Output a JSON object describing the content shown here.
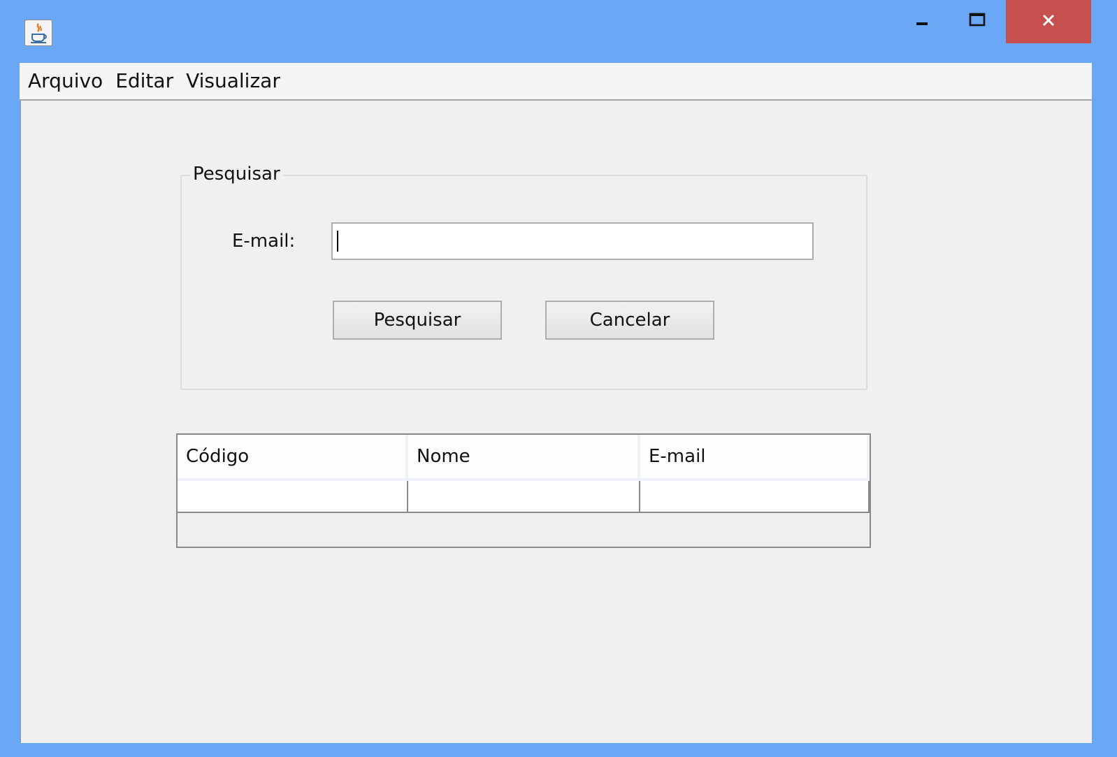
{
  "window": {
    "icon": "java-cup-icon",
    "controls": {
      "minimize": "minimize-icon",
      "maximize": "maximize-icon",
      "close": "close-icon"
    },
    "colors": {
      "titlebar": "#6aa8f5",
      "close_button": "#c7504f"
    }
  },
  "menubar": {
    "items": [
      {
        "label": "Arquivo"
      },
      {
        "label": "Editar"
      },
      {
        "label": "Visualizar"
      }
    ]
  },
  "search_panel": {
    "legend": "Pesquisar",
    "email_label": "E-mail:",
    "email_value": "",
    "search_button": "Pesquisar",
    "cancel_button": "Cancelar"
  },
  "results_table": {
    "columns": [
      "Código",
      "Nome",
      "E-mail"
    ],
    "rows": [
      [
        "",
        "",
        ""
      ]
    ]
  }
}
